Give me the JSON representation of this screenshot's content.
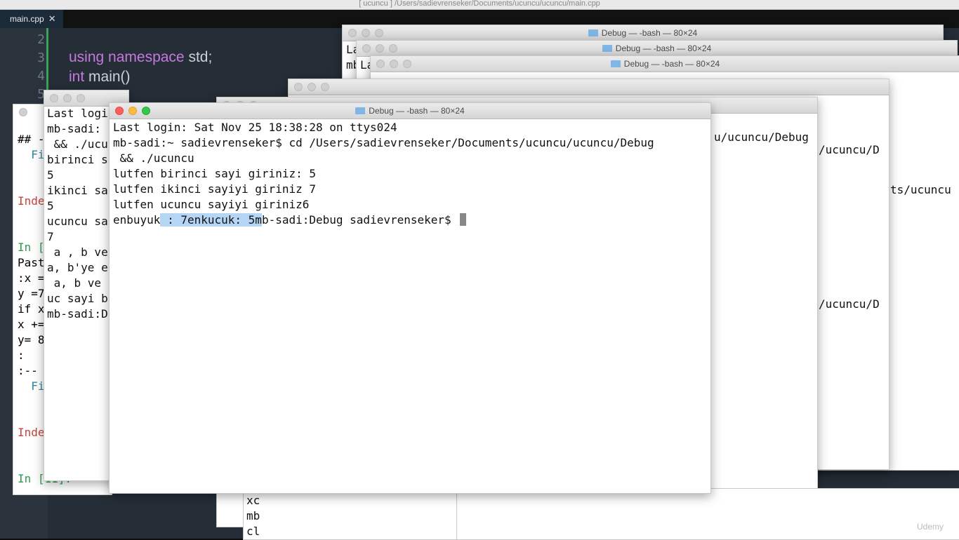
{
  "topbar": {
    "title": "[ ucuncu ] /Users/sadievrenseker/Documents/ucuncu/ucuncu/main.cpp"
  },
  "editor": {
    "tab_label": "main.cpp",
    "tab_close": "✕",
    "line_numbers": [
      "2",
      "3",
      "4",
      "5"
    ],
    "code_line_3_kw": "using namespace",
    "code_line_3_rest": " std;",
    "code_line_4_kw": "int",
    "code_line_4_rest": " main()"
  },
  "background_windows": {
    "title": "Debug — -bash — 80×24",
    "right_snippets": [
      "u/ucuncu/Debug",
      "/ucuncu/D",
      "ts/ucuncu",
      "/ucuncu/D"
    ],
    "right_win_top_fragments": [
      "La",
      "mb",
      "La"
    ],
    "bottom_fragments": [
      "xc",
      "mb",
      "cl"
    ]
  },
  "left_terminal": {
    "lines": [
      "Last logi",
      "mb-sadi:",
      " && ./ucu",
      "birinci s",
      "5",
      "ikinci sa",
      "5",
      "ucuncu sa",
      "7",
      " a , b ve",
      "a, b'ye e",
      " a, b ve",
      "uc sayi b",
      "mb-sadi:D"
    ]
  },
  "left_panel": {
    "lines": [
      {
        "t": "## -",
        "c": ""
      },
      {
        "t": "  Fi",
        "c": "cyanT"
      },
      {
        "t": "",
        "c": ""
      },
      {
        "t": "",
        "c": ""
      },
      {
        "t": "Inde",
        "c": "redT"
      },
      {
        "t": "",
        "c": ""
      },
      {
        "t": "",
        "c": ""
      },
      {
        "t": "In [",
        "c": "grnT"
      },
      {
        "t": "Past",
        "c": ""
      },
      {
        "t": ":x =",
        "c": ""
      },
      {
        "t": "y =7",
        "c": ""
      },
      {
        "t": "if x",
        "c": ""
      },
      {
        "t": "x +=",
        "c": ""
      },
      {
        "t": "y= 8",
        "c": ""
      },
      {
        "t": ":",
        "c": ""
      },
      {
        "t": ":--",
        "c": ""
      },
      {
        "t": "  Fi",
        "c": "cyanT"
      },
      {
        "t": "",
        "c": ""
      },
      {
        "t": "",
        "c": ""
      },
      {
        "t": "Inde",
        "c": "redT"
      },
      {
        "t": "",
        "c": ""
      },
      {
        "t": "",
        "c": ""
      },
      {
        "t": "In [11]: ",
        "c": "grnT"
      }
    ]
  },
  "main_terminal": {
    "title": "Debug — -bash — 80×24",
    "line1": "Last login: Sat Nov 25 18:38:28 on ttys024",
    "line2": "mb-sadi:~ sadievrenseker$ cd /Users/sadievrenseker/Documents/ucuncu/ucuncu/Debug",
    "line3": " && ./ucuncu",
    "line4": "lutfen birinci sayi giriniz: 5",
    "line5": "lutfen ikinci sayiyi giriniz 7",
    "line6": "lutfen ucuncu sayiyi giriniz6",
    "line7_pre": "enbuyuk",
    "line7_hl": " : 7enkucuk: 5m",
    "line7_post": "b-sadi:Debug sadievrenseker$ "
  },
  "watermark": "Udemy"
}
